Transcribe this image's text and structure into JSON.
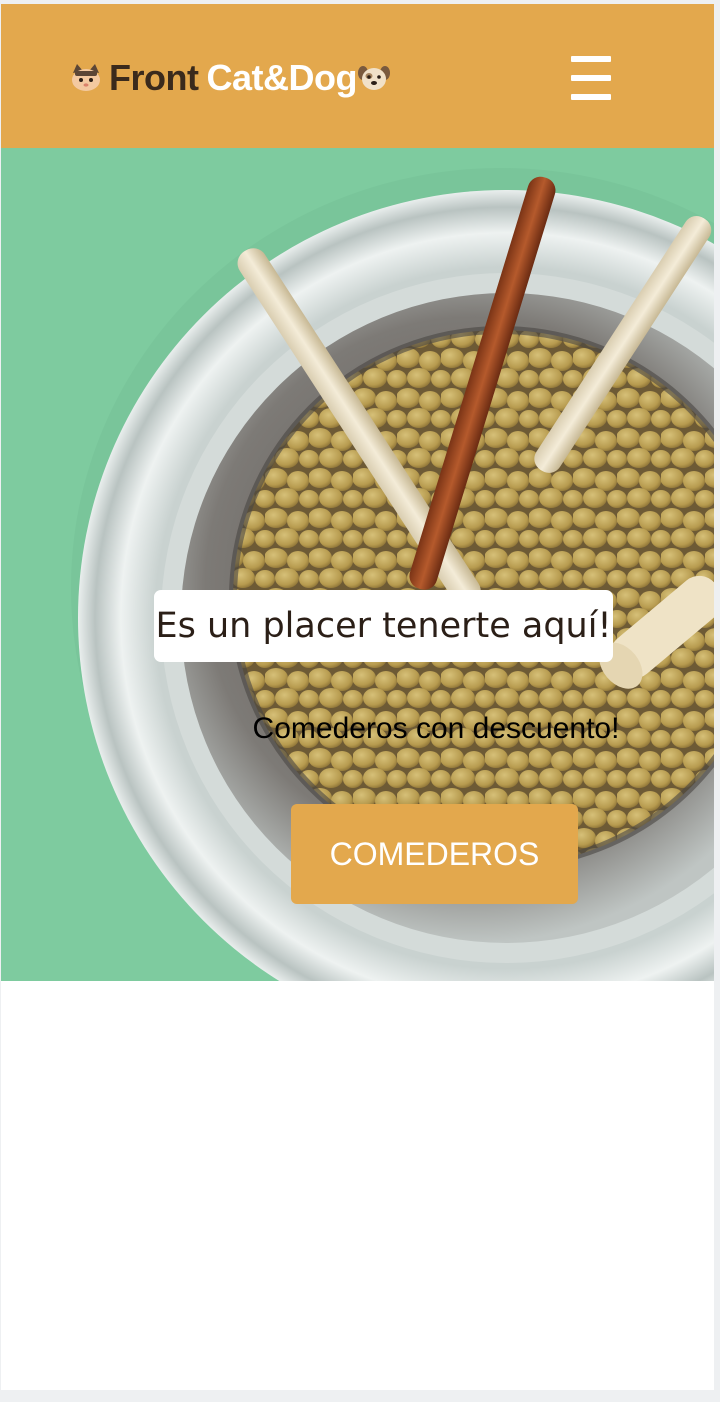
{
  "header": {
    "logo": {
      "part1": "Front",
      "part2": "Cat&Dog",
      "left_icon": "cat-icon",
      "right_icon": "dog-icon"
    },
    "menu_icon": "hamburger-menu-icon",
    "background_color": "#e3a84d"
  },
  "hero": {
    "image": "pet-food-bowl-with-chew-sticks",
    "background_color": "#7ecb9f",
    "welcome": "Es un placer tenerte aquí!",
    "promo": "Comederos con descuento!",
    "cta_label": "COMEDEROS"
  },
  "colors": {
    "accent": "#e3a84d",
    "text_dark": "#2b1f17",
    "white": "#ffffff"
  }
}
